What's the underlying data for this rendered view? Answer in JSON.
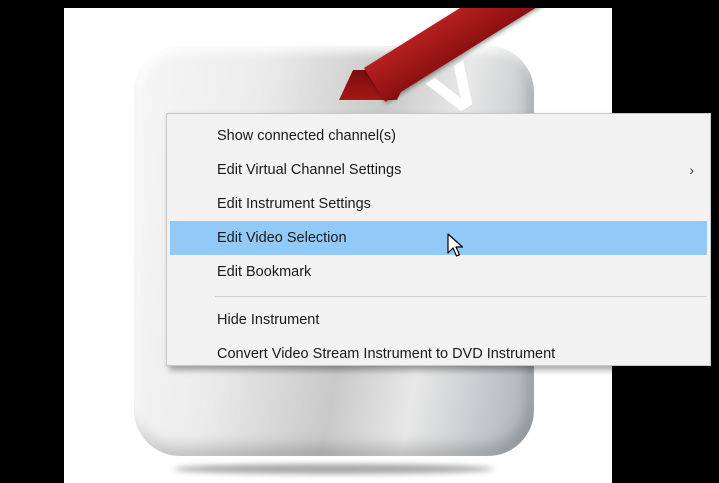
{
  "context_menu": {
    "items": [
      {
        "label": "Show connected channel(s)",
        "has_submenu": false,
        "highlighted": false
      },
      {
        "label": "Edit Virtual Channel Settings",
        "has_submenu": true,
        "highlighted": false
      },
      {
        "label": "Edit Instrument Settings",
        "has_submenu": false,
        "highlighted": false
      },
      {
        "label": "Edit Video Selection",
        "has_submenu": false,
        "highlighted": true
      },
      {
        "label": "Edit Bookmark",
        "has_submenu": false,
        "highlighted": false
      }
    ],
    "items_after_separator": [
      {
        "label": "Hide Instrument",
        "has_submenu": false,
        "highlighted": false
      },
      {
        "label": "Convert Video Stream Instrument to DVD Instrument",
        "has_submenu": false,
        "highlighted": false
      }
    ],
    "submenu_arrow": "›",
    "highlight_color": "#91c9f7",
    "background_color": "#f2f2f2"
  },
  "instrument_icon": {
    "ribbon_text": "V",
    "ribbon_color": "#a51818",
    "name": "instrument-icon"
  },
  "cursor": {
    "icon": "arrow-pointer-icon"
  }
}
